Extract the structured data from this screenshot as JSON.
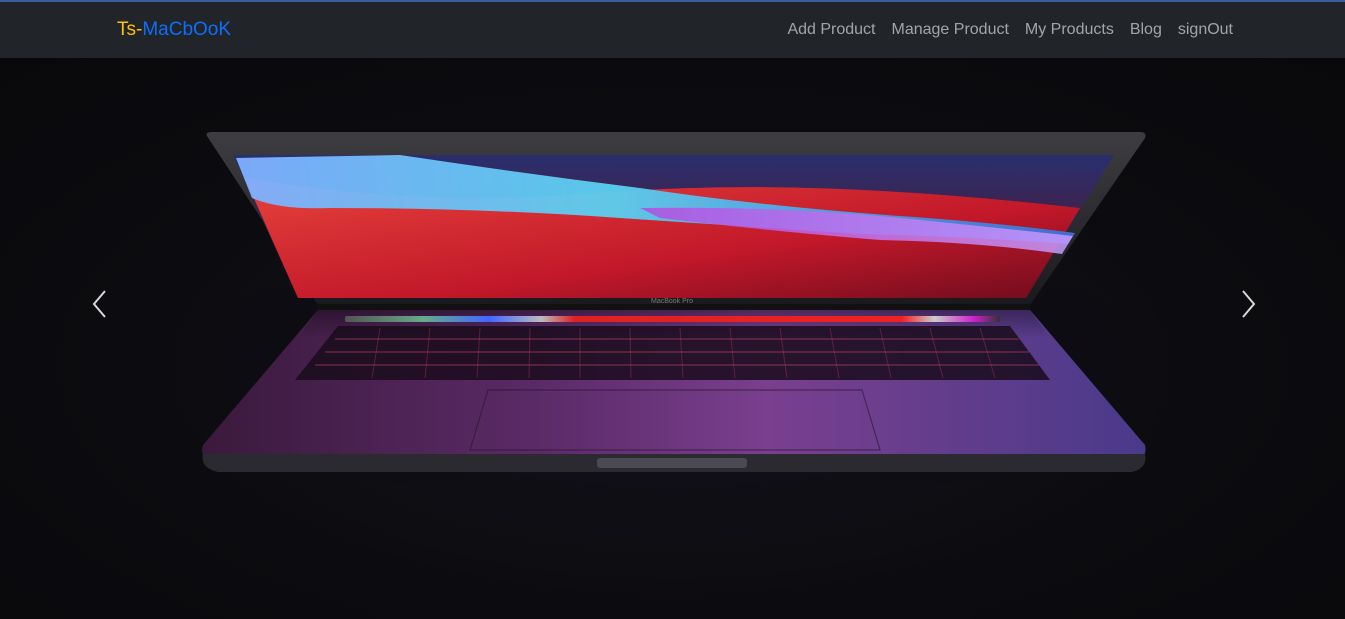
{
  "navbar": {
    "brand_part1": "Ts-",
    "brand_part2": "MaCbOoK",
    "links": [
      "Add Product",
      "Manage Product",
      "My Products",
      "Blog",
      "signOut"
    ]
  },
  "carousel": {
    "screen_label": "MacBook Pro"
  },
  "colors": {
    "navbar_bg": "#212529",
    "brand_yellow": "#ffc107",
    "brand_blue": "#0d6efd"
  },
  "icons": {
    "prev": "chevron-left-icon",
    "next": "chevron-right-icon"
  }
}
